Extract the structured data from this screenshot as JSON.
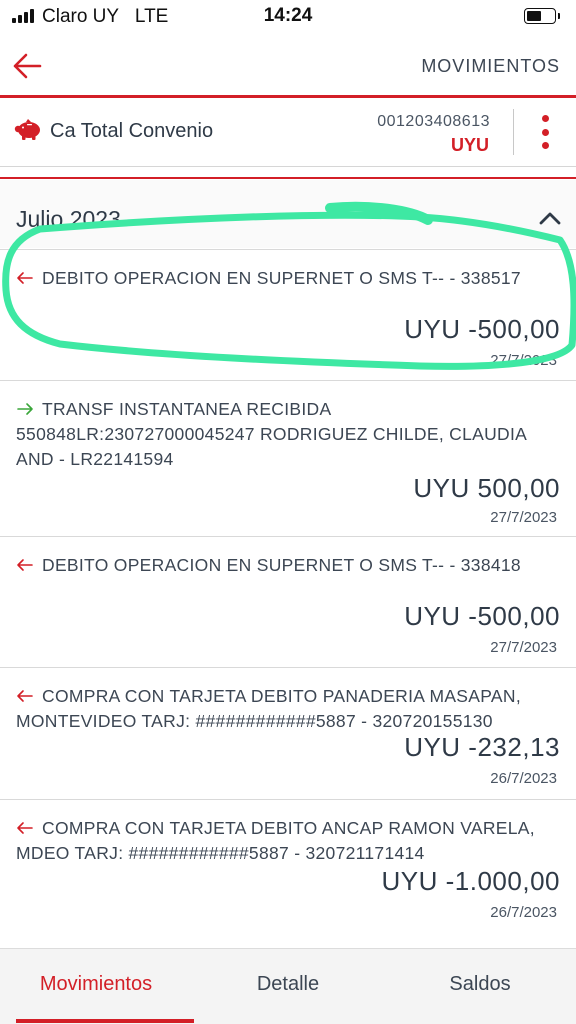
{
  "status_bar": {
    "carrier": "Claro UY",
    "network": "LTE",
    "time": "14:24",
    "battery_level": 0.55
  },
  "header": {
    "title": "MOVIMIENTOS",
    "back_icon": "arrow-left-icon"
  },
  "account": {
    "name": "Ca Total Convenio",
    "number": "001203408613",
    "currency": "UYU",
    "icon": "piggy-bank-icon"
  },
  "month": {
    "label": "Julio 2023",
    "toggle_icon": "chevron-up-icon"
  },
  "transactions": [
    {
      "direction": "out",
      "description": "DEBITO OPERACION EN SUPERNET O SMS T-- - 338517",
      "amount": "UYU -500,00",
      "date": "27/7/2023"
    },
    {
      "direction": "in",
      "description": "TRANSF INSTANTANEA RECIBIDA 550848LR:230727000045247 RODRIGUEZ CHILDE, CLAUDIA AND - LR22141594",
      "amount": "UYU 500,00",
      "date": "27/7/2023"
    },
    {
      "direction": "out",
      "description": "DEBITO OPERACION EN SUPERNET O SMS T-- - 338418",
      "amount": "UYU -500,00",
      "date": "27/7/2023"
    },
    {
      "direction": "out",
      "description": "COMPRA CON TARJETA DEBITO PANADERIA MASAPAN, MONTEVIDEO TARJ: ############5887 - 320720155130",
      "amount": "UYU -232,13",
      "date": "26/7/2023"
    },
    {
      "direction": "out",
      "description": "COMPRA CON TARJETA DEBITO ANCAP RAMON VARELA, MDEO TARJ: ############5887 - 320721171414",
      "amount": "UYU -1.000,00",
      "date": "26/7/2023"
    }
  ],
  "tabs": [
    {
      "label": "Movimientos",
      "active": true
    },
    {
      "label": "Detalle",
      "active": false
    },
    {
      "label": "Saldos",
      "active": false
    }
  ],
  "colors": {
    "brand_red": "#d31f27",
    "text": "#3c4653",
    "incoming_arrow": "#3aa63a",
    "highlight": "#3ee8a3"
  }
}
